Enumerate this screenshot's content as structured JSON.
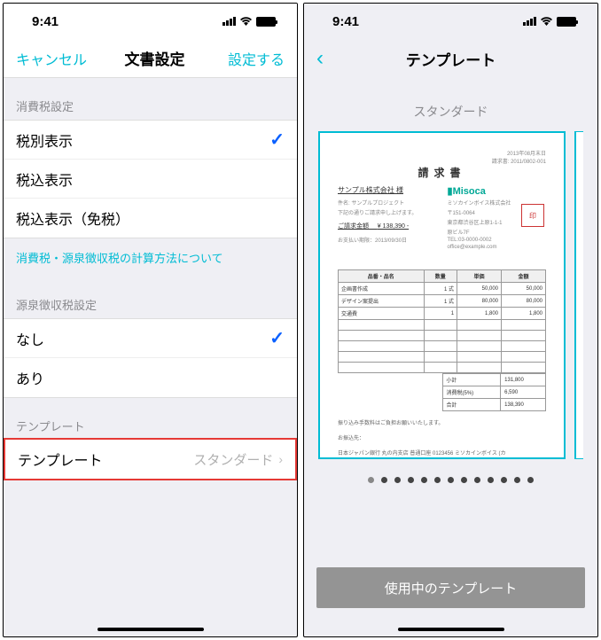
{
  "status": {
    "time": "9:41"
  },
  "screen1": {
    "nav": {
      "cancel": "キャンセル",
      "title": "文書設定",
      "action": "設定する"
    },
    "sections": {
      "tax": {
        "header": "消費税設定",
        "options": [
          {
            "label": "税別表示",
            "selected": true
          },
          {
            "label": "税込表示",
            "selected": false
          },
          {
            "label": "税込表示（免税）",
            "selected": false
          }
        ],
        "info_link": "消費税・源泉徴収税の計算方法について"
      },
      "withholding": {
        "header": "源泉徴収税設定",
        "options": [
          {
            "label": "なし",
            "selected": true
          },
          {
            "label": "あり",
            "selected": false
          }
        ]
      },
      "template": {
        "header": "テンプレート",
        "row_label": "テンプレート",
        "row_value": "スタンダード"
      }
    }
  },
  "screen2": {
    "nav_title": "テンプレート",
    "selected_name": "スタンダード",
    "bottom_button": "使用中のテンプレート",
    "page_dots": {
      "count": 13,
      "active_index": 0
    },
    "preview": {
      "date": "2013年08月末日",
      "doc_no": "請求書: 2011/0802-001",
      "title": "請求書",
      "client": "サンプル株式会社 様",
      "subject_label": "件名: サンプルプロジェクト",
      "greeting": "下記の通りご請求申し上げます。",
      "amount_label": "ご請求金額",
      "amount": "¥ 138,390 -",
      "payment_due": "お支払い期限：2013/09/30日",
      "logo": "Misoca",
      "company": "ミソカインボイス株式会社",
      "postal": "〒151-0064",
      "addr1": "東京都渋谷区上原1-1-1",
      "addr2": "原ビル7F",
      "tel": "TEL:03-0000-0002",
      "email": "office@example.com",
      "table": {
        "headers": [
          "品番・品名",
          "数量",
          "単価",
          "金額"
        ],
        "rows": [
          {
            "name": "企画書作成",
            "qty": "1 式",
            "price": "50,000",
            "amount": "50,000"
          },
          {
            "name": "デザイン案提出",
            "qty": "1 式",
            "price": "80,000",
            "amount": "80,000"
          },
          {
            "name": "交通費",
            "qty": "1",
            "price": "1,800",
            "amount": "1,800"
          }
        ]
      },
      "totals": {
        "subtotal_label": "小計",
        "subtotal": "131,800",
        "tax_label": "消費税(5%)",
        "tax": "6,590",
        "total_label": "合計",
        "total": "138,390"
      },
      "footer_note": "振り込み手数料はご負担お願いいたします。",
      "bank_label": "お振込先：",
      "bank": "日本ジャパン銀行 丸の内支店 普通口座 0123456 ミソカインボイス (カ"
    }
  }
}
